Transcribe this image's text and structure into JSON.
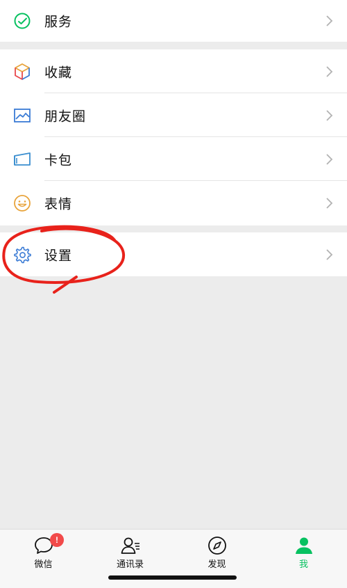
{
  "menu": {
    "services": {
      "label": "服务",
      "icon": "services-icon"
    },
    "favorites": {
      "label": "收藏",
      "icon": "cube-icon"
    },
    "moments": {
      "label": "朋友圈",
      "icon": "image-icon"
    },
    "cards": {
      "label": "卡包",
      "icon": "wallet-icon"
    },
    "stickers": {
      "label": "表情",
      "icon": "smile-icon"
    },
    "settings": {
      "label": "设置",
      "icon": "gear-icon"
    }
  },
  "tabbar": {
    "chats": {
      "label": "微信",
      "badge": "!"
    },
    "contacts": {
      "label": "通讯录"
    },
    "discover": {
      "label": "发现"
    },
    "me": {
      "label": "我"
    }
  },
  "colors": {
    "accent": "#07c160",
    "annotation": "#e8221b",
    "badge": "#f24a4a",
    "background": "#ececec"
  }
}
